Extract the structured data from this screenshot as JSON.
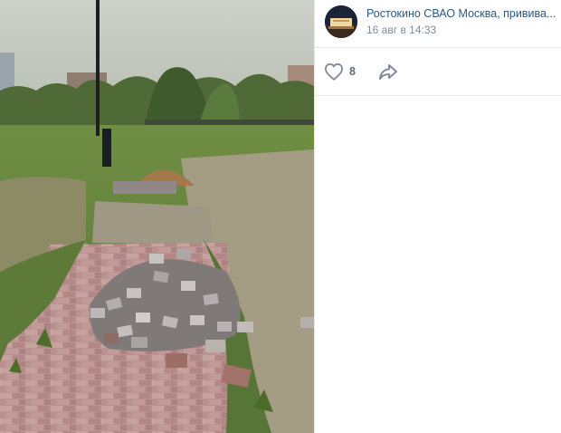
{
  "post": {
    "author": "Ростокино СВАО Москва, привива...",
    "date": "16 авг в 14:33",
    "likes": "8"
  },
  "photo": {
    "subject": "park-paving-stones"
  },
  "icons": {
    "like": "heart-icon",
    "share": "share-arrow-icon"
  },
  "colors": {
    "link": "#2a5885",
    "meta": "#818c99",
    "icon": "#828a99"
  }
}
